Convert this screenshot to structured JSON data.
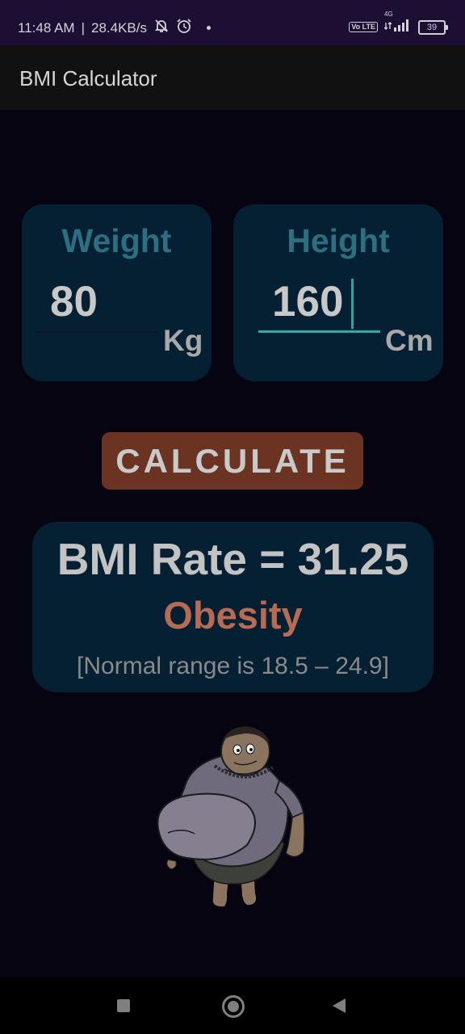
{
  "status_bar": {
    "time": "11:48 AM",
    "separator": "|",
    "net_speed": "28.4KB/s",
    "network_type": "4G",
    "volte_label": "Vo LTE",
    "battery_level": "39"
  },
  "app_bar": {
    "title": "BMI Calculator"
  },
  "weight": {
    "label": "Weight",
    "value": "80",
    "unit": "Kg"
  },
  "height": {
    "label": "Height",
    "value": "160",
    "unit": "Cm"
  },
  "calculate_button": {
    "label": "CALCULATE"
  },
  "result": {
    "bmi_text": "BMI Rate = 31.25",
    "category": "Obesity",
    "range_note": "[Normal range is 18.5 – 24.9]"
  },
  "colors": {
    "background": "#070411",
    "card": "#052033",
    "label_teal": "#2b6f80",
    "button": "#6a3322",
    "category": "#b76a54",
    "focus_line": "#33a7a3"
  },
  "icons": {
    "status": [
      "mute-bell-icon",
      "alarm-icon",
      "dot-icon",
      "volte-icon",
      "signal-icon",
      "battery-icon"
    ],
    "nav": [
      "recents-square-icon",
      "home-circle-icon",
      "back-triangle-icon"
    ]
  }
}
